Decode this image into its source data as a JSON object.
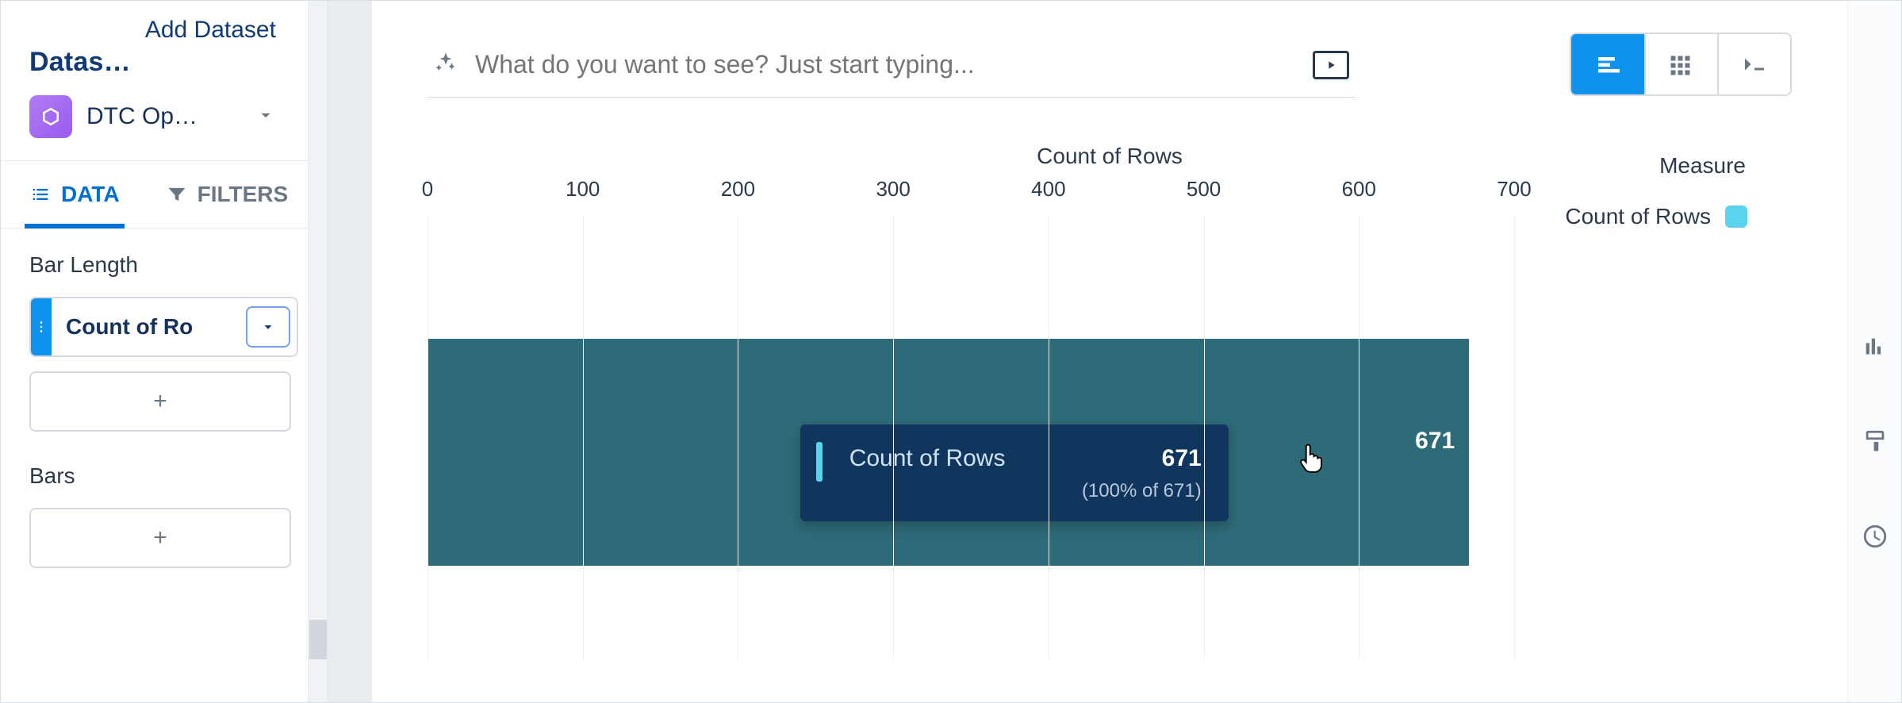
{
  "sidebar": {
    "datasets_label": "Datas…",
    "add_dataset": "Add Dataset",
    "selected_dataset": "DTC Op…"
  },
  "tabs": {
    "data": "DATA",
    "filters": "FILTERS"
  },
  "panels": {
    "bar_length_title": "Bar Length",
    "bar_length_pill": "Count of Ro",
    "bars_title": "Bars",
    "plus": "+"
  },
  "query": {
    "placeholder": "What do you want to see? Just start typing..."
  },
  "chart_meta": {
    "axis_title": "Count of Rows",
    "measure_heading": "Measure",
    "legend_label": "Count of Rows",
    "bar_value_text": "671",
    "tooltip_label": "Count of Rows",
    "tooltip_value": "671",
    "tooltip_sub": "(100% of 671)"
  },
  "chart_data": {
    "type": "bar",
    "orientation": "horizontal",
    "categories": [
      ""
    ],
    "values": [
      671
    ],
    "title": "Count of Rows",
    "xlabel": "Count of Rows",
    "ylabel": "",
    "xlim": [
      0,
      700
    ],
    "xticks": [
      0,
      100,
      200,
      300,
      400,
      500,
      600,
      700
    ],
    "series": [
      {
        "name": "Count of Rows",
        "values": [
          671
        ]
      }
    ],
    "legend_position": "right",
    "grid": true,
    "bar_color": "#2e6b78",
    "accent_color": "#5bd3ef"
  }
}
